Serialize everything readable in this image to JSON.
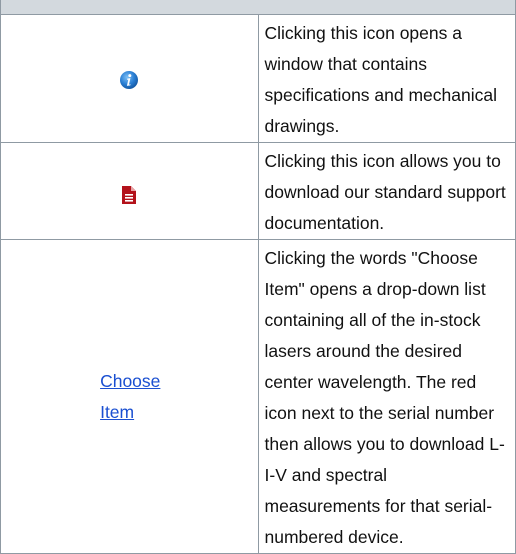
{
  "legend": {
    "rows": [
      {
        "icon": "info-icon",
        "description": "Clicking this icon opens a window that contains specifications and mechanical drawings."
      },
      {
        "icon": "document-icon",
        "description": "Clicking this icon allows you to download our standard support documentation."
      },
      {
        "link_label_line1": "Choose",
        "link_label_line2": "Item",
        "description": "Clicking the words \"Choose Item\" opens a drop-down list containing all of the in-stock lasers around the desired center wavelength. The red icon next to the serial number then allows you to download L-I-V and spectral measurements for that serial-numbered device."
      }
    ]
  },
  "colors": {
    "header_bg": "#d3d9de",
    "border": "#8f9aa3",
    "link": "#1a4fd1",
    "info_icon": "#2a7fd4",
    "doc_icon": "#b3121b"
  }
}
